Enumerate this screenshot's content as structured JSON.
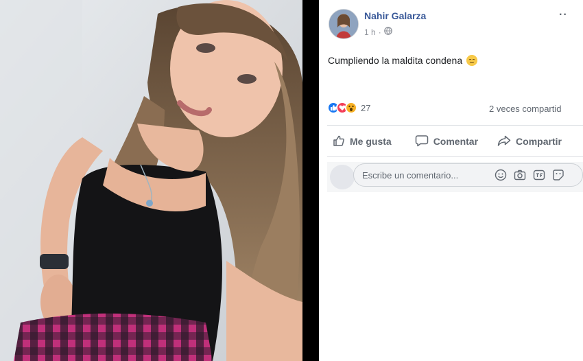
{
  "post": {
    "author": "Nahir Galarza",
    "time": "1 h",
    "text": "Cumpliendo la maldita condena",
    "more_label": "··",
    "reaction_count": "27",
    "shares": "2 veces compartid"
  },
  "actions": {
    "like": "Me gusta",
    "comment": "Comentar",
    "share": "Compartir"
  },
  "comment_box": {
    "placeholder": "Escribe un comentario..."
  },
  "icons": [
    "globe-icon",
    "smiley-icon",
    "like-reaction-icon",
    "love-reaction-icon",
    "wow-reaction-icon",
    "thumb-up-icon",
    "speech-bubble-icon",
    "share-arrow-icon",
    "emoji-icon",
    "camera-icon",
    "gif-icon",
    "sticker-icon"
  ],
  "colors": {
    "author": "#385898",
    "like_blue": "#1877f2",
    "love_red": "#f33e58",
    "wow_yellow": "#f7b125",
    "divider": "#000000"
  }
}
